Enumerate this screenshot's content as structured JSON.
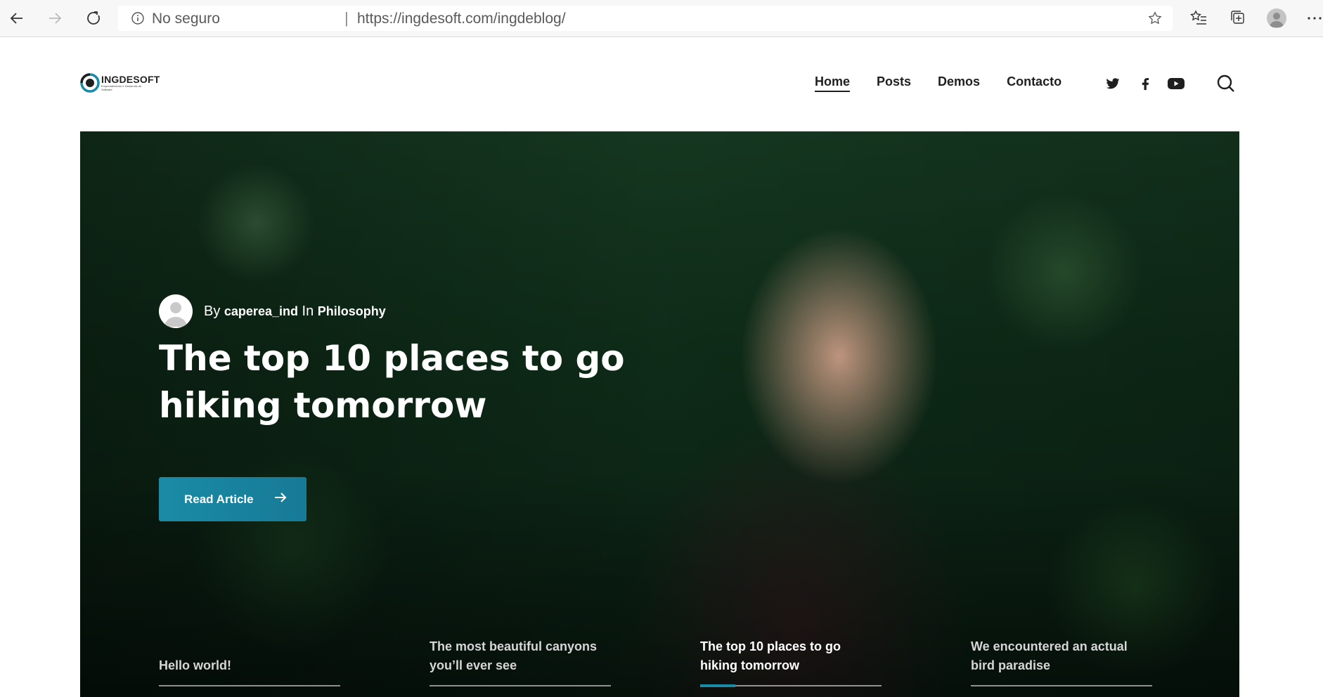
{
  "browser": {
    "security_label": "No seguro",
    "separator": "|",
    "url": "https://ingdesoft.com/ingdeblog/"
  },
  "site": {
    "logo": {
      "name": "INGDESOFT",
      "tagline": "Emprendimiento e Desarrollo de Software"
    },
    "nav": [
      "Home",
      "Posts",
      "Demos",
      "Contacto"
    ],
    "social_icons": [
      "twitter-icon",
      "facebook-icon",
      "youtube-icon"
    ]
  },
  "hero": {
    "by_label": "By",
    "author": "caperea_ind",
    "in_label": "In",
    "category": "Philosophy",
    "title": "The top 10 places to go hiking tomorrow",
    "button_label": "Read Article",
    "slides": [
      {
        "title": "Hello world!"
      },
      {
        "title": "The most beautiful canyons you’ll ever see"
      },
      {
        "title": "The top 10 places to go hiking tomorrow"
      },
      {
        "title": "We encountered an actual bird paradise"
      }
    ],
    "current_slide_index": 2,
    "colors": {
      "accent": "#1a8ba6",
      "foliage": "#163a22"
    }
  }
}
